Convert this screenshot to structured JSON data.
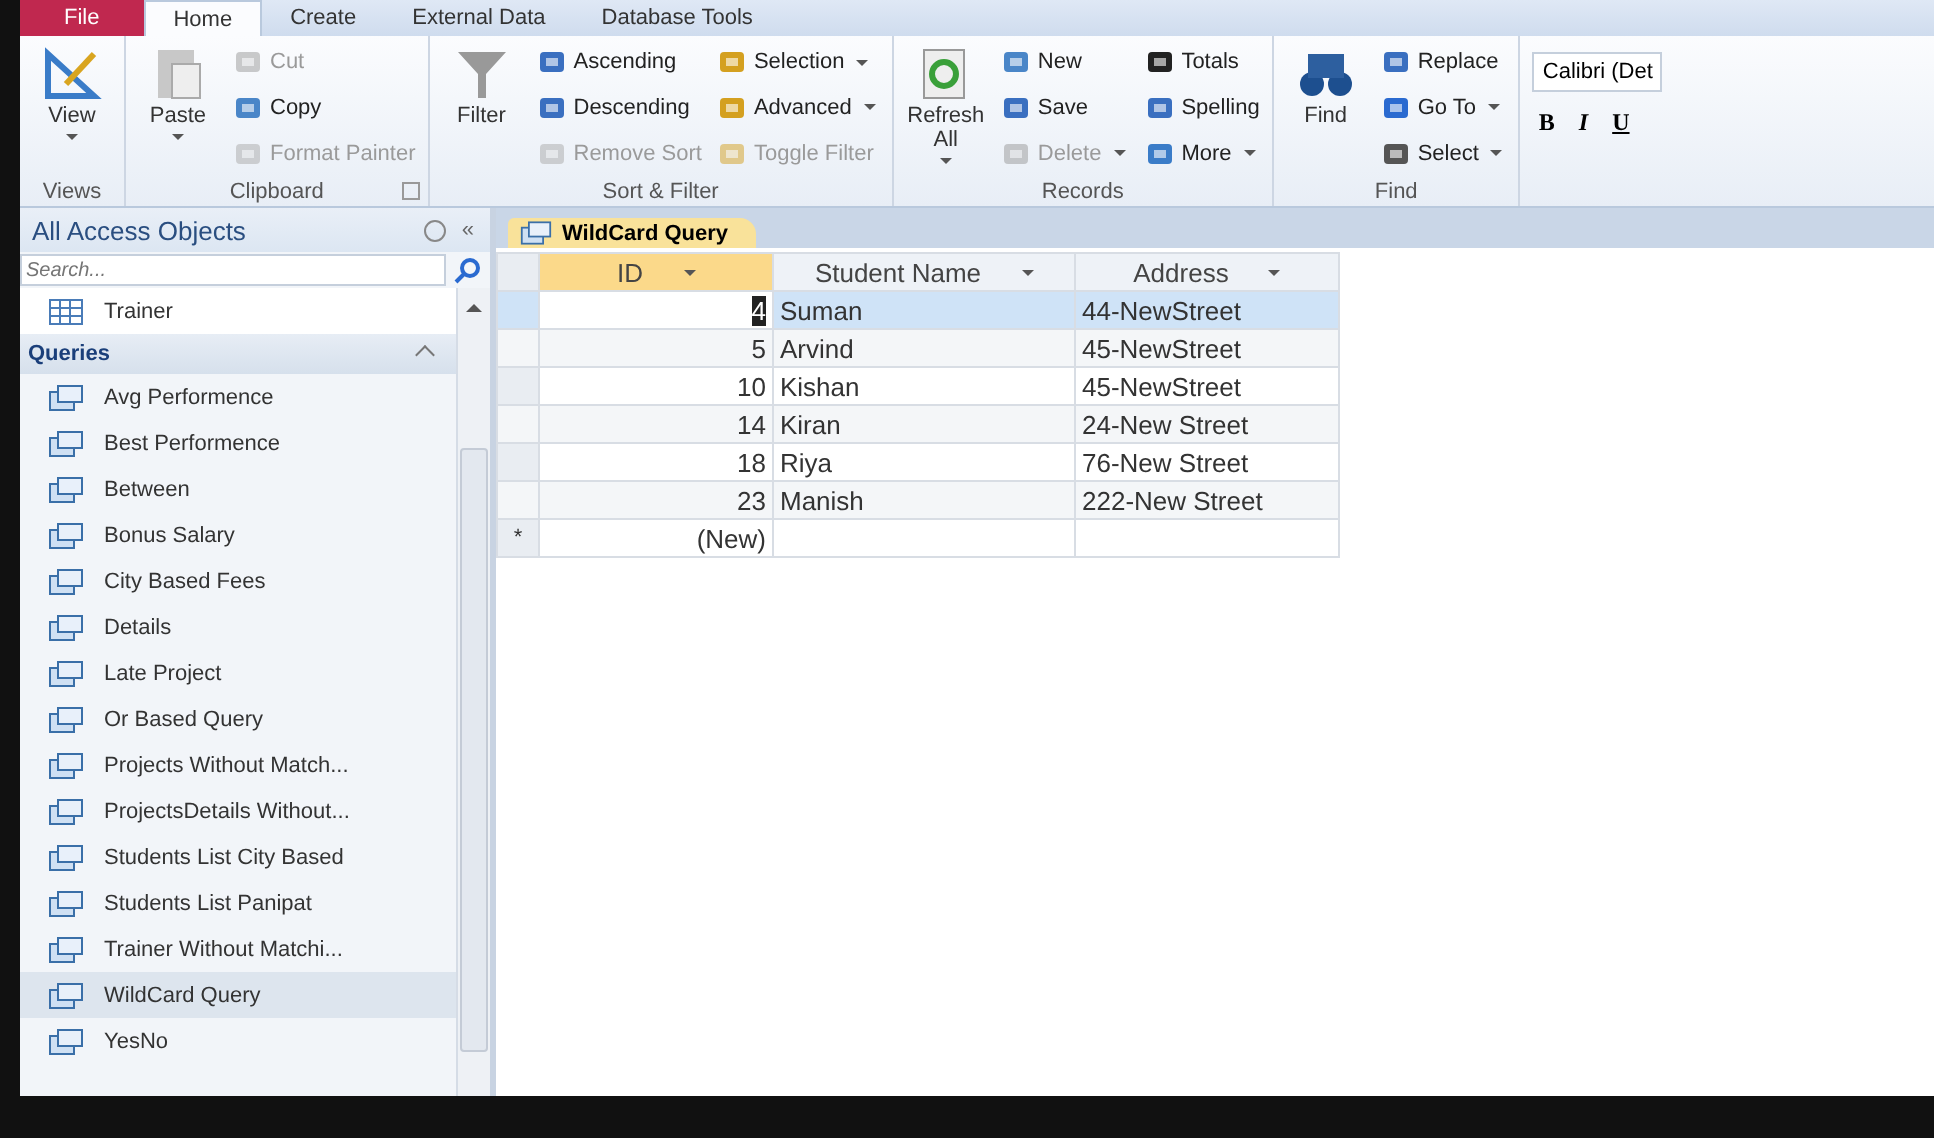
{
  "ribbon": {
    "tabs": [
      {
        "label": "File",
        "kind": "file",
        "selected": false
      },
      {
        "label": "Home",
        "kind": "tab",
        "selected": true
      },
      {
        "label": "Create",
        "kind": "tab",
        "selected": false
      },
      {
        "label": "External Data",
        "kind": "tab",
        "selected": false
      },
      {
        "label": "Database Tools",
        "kind": "tab",
        "selected": false
      }
    ],
    "groups": [
      {
        "label": "Views",
        "launcher": false,
        "large": [
          {
            "label": "View",
            "dropdown": true
          }
        ]
      },
      {
        "label": "Clipboard",
        "launcher": true,
        "large": [
          {
            "label": "Paste",
            "dropdown": true
          }
        ],
        "columns": [
          [
            {
              "label": "Cut",
              "disabled": true,
              "dropdown": false
            },
            {
              "label": "Copy",
              "disabled": false,
              "dropdown": false
            },
            {
              "label": "Format Painter",
              "disabled": true,
              "dropdown": false
            }
          ]
        ]
      },
      {
        "label": "Sort & Filter",
        "launcher": false,
        "large": [
          {
            "label": "Filter",
            "dropdown": false
          }
        ],
        "columns": [
          [
            {
              "label": "Ascending",
              "disabled": false,
              "dropdown": false
            },
            {
              "label": "Descending",
              "disabled": false,
              "dropdown": false
            },
            {
              "label": "Remove Sort",
              "disabled": true,
              "dropdown": false
            }
          ],
          [
            {
              "label": "Selection",
              "disabled": false,
              "dropdown": true
            },
            {
              "label": "Advanced",
              "disabled": false,
              "dropdown": true
            },
            {
              "label": "Toggle Filter",
              "disabled": true,
              "dropdown": false
            }
          ]
        ]
      },
      {
        "label": "Records",
        "launcher": false,
        "large": [
          {
            "label": "Refresh All",
            "dropdown": true
          }
        ],
        "columns": [
          [
            {
              "label": "New",
              "disabled": false,
              "dropdown": false
            },
            {
              "label": "Save",
              "disabled": false,
              "dropdown": false
            },
            {
              "label": "Delete",
              "disabled": true,
              "dropdown": true
            }
          ],
          [
            {
              "label": "Totals",
              "disabled": false,
              "dropdown": false
            },
            {
              "label": "Spelling",
              "disabled": false,
              "dropdown": false
            },
            {
              "label": "More",
              "disabled": false,
              "dropdown": true
            }
          ]
        ]
      },
      {
        "label": "Find",
        "launcher": false,
        "large": [
          {
            "label": "Find",
            "dropdown": false
          }
        ],
        "columns": [
          [
            {
              "label": "Replace",
              "disabled": false,
              "dropdown": false
            },
            {
              "label": "Go To",
              "disabled": false,
              "dropdown": true
            },
            {
              "label": "Select",
              "disabled": false,
              "dropdown": true
            }
          ]
        ]
      }
    ],
    "font": {
      "name": "Calibri (Det",
      "buttons": [
        "B",
        "I",
        "U"
      ]
    }
  },
  "navigation": {
    "title": "All Access Objects",
    "collapse": "«",
    "search": {
      "placeholder": "Search..."
    },
    "tables": [
      {
        "label": "Trainer",
        "selected": false
      }
    ],
    "queries_header": "Queries",
    "queries": [
      {
        "label": "Avg Performence",
        "selected": false
      },
      {
        "label": "Best Performence",
        "selected": false
      },
      {
        "label": "Between",
        "selected": false
      },
      {
        "label": "Bonus Salary",
        "selected": false
      },
      {
        "label": "City Based Fees",
        "selected": false
      },
      {
        "label": "Details",
        "selected": false
      },
      {
        "label": "Late Project",
        "selected": false
      },
      {
        "label": "Or Based Query",
        "selected": false
      },
      {
        "label": "Projects Without Match...",
        "selected": false
      },
      {
        "label": "ProjectsDetails Without...",
        "selected": false
      },
      {
        "label": "Students List City Based",
        "selected": false
      },
      {
        "label": "Students List Panipat",
        "selected": false
      },
      {
        "label": "Trainer Without Matchi...",
        "selected": false
      },
      {
        "label": "WildCard Query",
        "selected": true
      },
      {
        "label": "YesNo",
        "selected": false
      }
    ]
  },
  "datasheet": {
    "tab": "WildCard Query",
    "columns": [
      "ID",
      "Student Name",
      "Address"
    ],
    "rows": [
      {
        "id": "4",
        "name": "Suman",
        "address": "44-NewStreet",
        "selected": true
      },
      {
        "id": "5",
        "name": "Arvind",
        "address": "45-NewStreet",
        "selected": false
      },
      {
        "id": "10",
        "name": "Kishan",
        "address": "45-NewStreet",
        "selected": false
      },
      {
        "id": "14",
        "name": "Kiran",
        "address": "24-New Street",
        "selected": false
      },
      {
        "id": "18",
        "name": "Riya",
        "address": "76-New Street",
        "selected": false
      },
      {
        "id": "23",
        "name": "Manish",
        "address": "222-New Street",
        "selected": false
      }
    ],
    "new_row": {
      "marker": "*",
      "id": "(New)"
    }
  }
}
